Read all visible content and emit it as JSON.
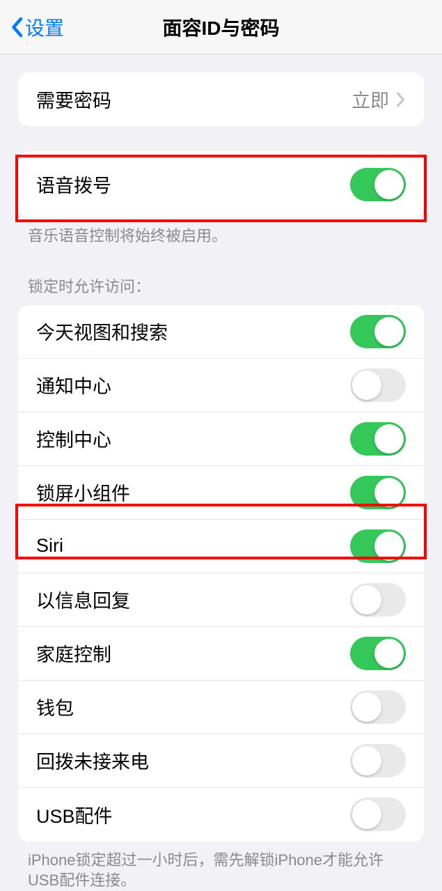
{
  "header": {
    "back_label": "设置",
    "title": "面容ID与密码"
  },
  "require_passcode": {
    "label": "需要密码",
    "value": "立即"
  },
  "voice_dial": {
    "label": "语音拨号",
    "on": true,
    "footnote": "音乐语音控制将始终被启用。"
  },
  "locked_access": {
    "header": "锁定时允许访问：",
    "items": [
      {
        "label": "今天视图和搜索",
        "on": true
      },
      {
        "label": "通知中心",
        "on": false
      },
      {
        "label": "控制中心",
        "on": true
      },
      {
        "label": "锁屏小组件",
        "on": true
      },
      {
        "label": "Siri",
        "on": true
      },
      {
        "label": "以信息回复",
        "on": false
      },
      {
        "label": "家庭控制",
        "on": true
      },
      {
        "label": "钱包",
        "on": false
      },
      {
        "label": "回拨未接来电",
        "on": false
      },
      {
        "label": "USB配件",
        "on": false
      }
    ],
    "footnote": "iPhone锁定超过一小时后，需先解锁iPhone才能允许USB配件连接。"
  }
}
